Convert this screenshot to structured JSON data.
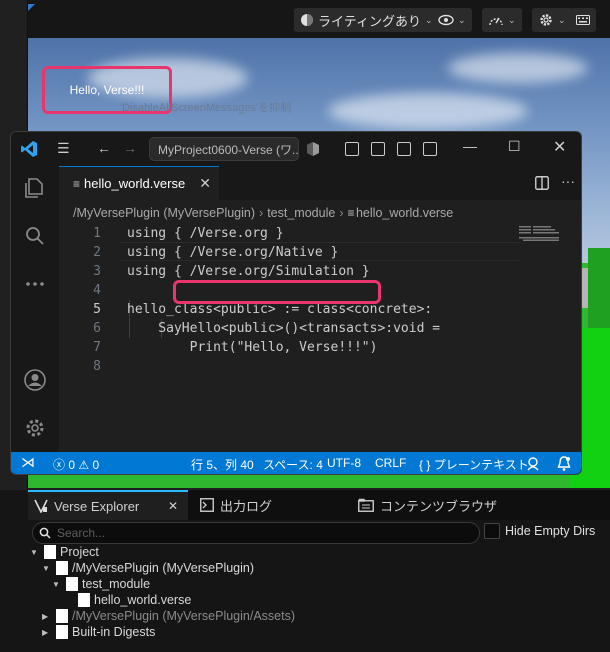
{
  "viewport": {
    "lighting_label": "ライティングあり",
    "hello_text": "Hello, Verse!!!",
    "disable_msg": "'DisableAllScreenMessages'を抑制"
  },
  "vscode": {
    "title": "MyProject0600-Verse (ワ...",
    "tab": {
      "label": "hello_world.verse"
    },
    "breadcrumb": [
      "/MyVersePlugin (MyVersePlugin)",
      "test_module",
      "hello_world.verse"
    ],
    "code_lines": [
      {
        "n": "1",
        "text": "using { /Verse.org }"
      },
      {
        "n": "2",
        "text": "using { /Verse.org/Native }"
      },
      {
        "n": "3",
        "text": "using { /Verse.org/Simulation }"
      },
      {
        "n": "4",
        "text": ""
      },
      {
        "n": "5",
        "text": "hello_class<public> := class<concrete>:"
      },
      {
        "n": "6",
        "text": "    SayHello<public>()<transacts>:void ="
      },
      {
        "n": "7",
        "text": "        Print(\"Hello, Verse!!!\")"
      },
      {
        "n": "8",
        "text": ""
      }
    ],
    "status": {
      "errors": "0",
      "warnings": "0",
      "position": "行 5、列 40",
      "spaces": "スペース: 4",
      "encoding": "UTF-8",
      "eol": "CRLF",
      "language": "プレーンテキスト"
    },
    "colors": {
      "status_bg": "#0078d4",
      "highlight": "#e8356d"
    }
  },
  "panel": {
    "tabs": [
      "Verse Explorer",
      "出力ログ",
      "コンテンツブラウザ"
    ],
    "search_placeholder": "Search...",
    "hide_empty_label": "Hide Empty Dirs",
    "tree": [
      {
        "label": "Project",
        "depth": 0,
        "expanded": true,
        "dim": false
      },
      {
        "label": "/MyVersePlugin (MyVersePlugin)",
        "depth": 1,
        "expanded": true,
        "dim": false
      },
      {
        "label": "test_module",
        "depth": 2,
        "expanded": true,
        "dim": false
      },
      {
        "label": "hello_world.verse",
        "depth": 3,
        "expanded": false,
        "dim": false
      },
      {
        "label": "/MyVersePlugin (MyVersePlugin/Assets)",
        "depth": 1,
        "expanded": false,
        "dim": true
      },
      {
        "label": "Built-in Digests",
        "depth": 1,
        "expanded": false,
        "dim": false
      }
    ]
  }
}
